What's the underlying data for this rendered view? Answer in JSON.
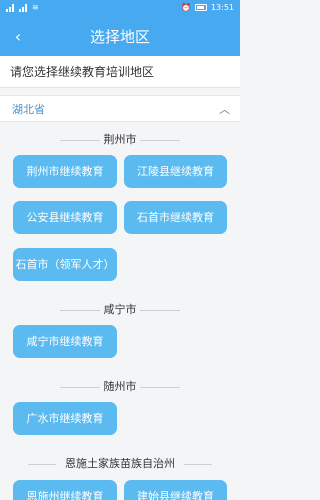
{
  "status": {
    "time": "13:51",
    "battery_icon": "battery-icon"
  },
  "header": {
    "title": "选择地区",
    "back_icon": "back-arrow-icon"
  },
  "instruction": "请您选择继续教育培训地区",
  "province": {
    "name": "湖北省",
    "toggle_icon": "chevron-up-icon"
  },
  "colors": {
    "accent": "#47a9f0",
    "pill": "#5bbaf0",
    "province_text": "#4a90c8"
  },
  "sections": [
    {
      "name": "荆州市",
      "items": [
        "荆州市继续教育",
        "江陵县继续教育",
        "公安县继续教育",
        "石首市继续教育",
        "石首市（领军人才）"
      ]
    },
    {
      "name": "咸宁市",
      "items": [
        "咸宁市继续教育"
      ]
    },
    {
      "name": "随州市",
      "items": [
        "广水市继续教育"
      ]
    },
    {
      "name": "恩施土家族苗族自治州",
      "items": [
        "恩施州继续教育",
        "建始县继续教育"
      ]
    }
  ]
}
